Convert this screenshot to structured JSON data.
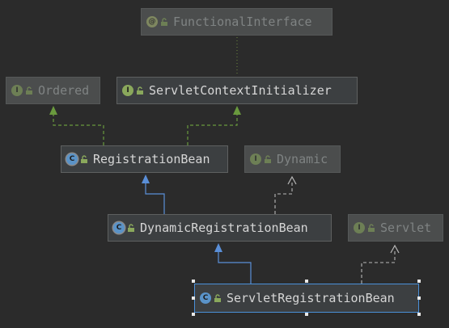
{
  "colors": {
    "background": "#2b2b2b",
    "interface_badge": "#8aa85c",
    "annotation_badge": "#a9b770",
    "class_badge": "#5a93c8",
    "implements_arrow": "#6a9a3e",
    "extends_arrow": "#5a8fd8",
    "dim_arrow": "#b8b8b8",
    "selection": "#4a90d9"
  },
  "nodes": {
    "functional_interface": {
      "kind": "annotation",
      "badge": "@",
      "label": "FunctionalInterface"
    },
    "ordered": {
      "kind": "interface",
      "badge": "I",
      "label": "Ordered"
    },
    "servlet_context_initializer": {
      "kind": "interface",
      "badge": "I",
      "label": "ServletContextInitializer"
    },
    "registration_bean": {
      "kind": "abstract-class",
      "badge": "C",
      "label": "RegistrationBean"
    },
    "dynamic": {
      "kind": "interface",
      "badge": "I",
      "label": "Dynamic"
    },
    "dynamic_registration_bean": {
      "kind": "abstract-class",
      "badge": "C",
      "label": "DynamicRegistrationBean"
    },
    "servlet": {
      "kind": "interface",
      "badge": "I",
      "label": "Servlet"
    },
    "servlet_registration_bean": {
      "kind": "class",
      "badge": "C",
      "label": "ServletRegistrationBean"
    }
  },
  "edges": [
    {
      "from": "servlet_context_initializer",
      "to": "functional_interface",
      "type": "annotated"
    },
    {
      "from": "registration_bean",
      "to": "ordered",
      "type": "implements"
    },
    {
      "from": "registration_bean",
      "to": "servlet_context_initializer",
      "type": "implements"
    },
    {
      "from": "dynamic_registration_bean",
      "to": "registration_bean",
      "type": "extends"
    },
    {
      "from": "dynamic_registration_bean",
      "to": "dynamic",
      "type": "implements"
    },
    {
      "from": "servlet_registration_bean",
      "to": "dynamic_registration_bean",
      "type": "extends"
    },
    {
      "from": "servlet_registration_bean",
      "to": "servlet",
      "type": "implements"
    }
  ]
}
